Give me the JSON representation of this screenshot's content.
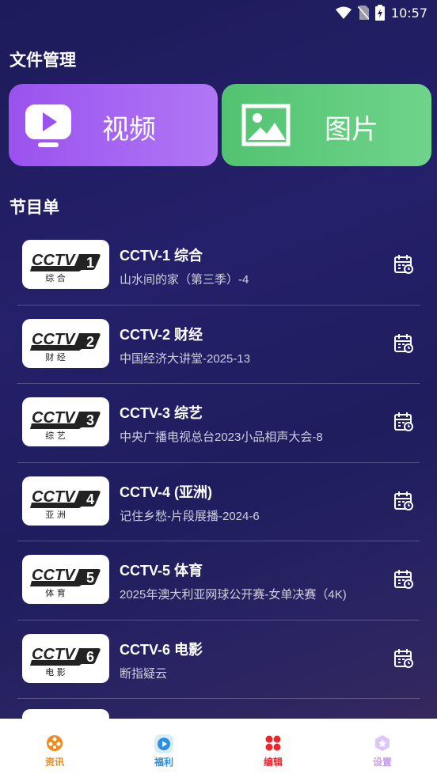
{
  "status_bar": {
    "time": "10:57"
  },
  "file_section": {
    "title": "文件管理",
    "video_label": "视频",
    "image_label": "图片"
  },
  "program_section": {
    "title": "节目单",
    "items": [
      {
        "name": "CCTV-1 综合",
        "program": "山水间的家（第三季）-4",
        "logo_num": "1",
        "logo_text": "综 合"
      },
      {
        "name": "CCTV-2 财经",
        "program": "中国经济大讲堂-2025-13",
        "logo_num": "2",
        "logo_text": "财 经"
      },
      {
        "name": "CCTV-3 综艺",
        "program": "中央广播电视总台2023小品相声大会-8",
        "logo_num": "3",
        "logo_text": "综 艺"
      },
      {
        "name": "CCTV-4 (亚洲)",
        "program": "记住乡愁-片段展播-2024-6",
        "logo_num": "4",
        "logo_text": "亚 洲"
      },
      {
        "name": "CCTV-5 体育",
        "program": "2025年澳大利亚网球公开赛-女单决赛（4K)",
        "logo_num": "5",
        "logo_text": "体 育"
      },
      {
        "name": "CCTV-6 电影",
        "program": "断指疑云",
        "logo_num": "6",
        "logo_text": "电 影"
      }
    ]
  },
  "tabbar": {
    "tabs": [
      {
        "label": "资讯",
        "color": "#f08a1c"
      },
      {
        "label": "福利",
        "color": "#2d8fe0"
      },
      {
        "label": "编辑",
        "color": "#e8262e"
      },
      {
        "label": "设置",
        "color": "#c79af5"
      }
    ]
  }
}
